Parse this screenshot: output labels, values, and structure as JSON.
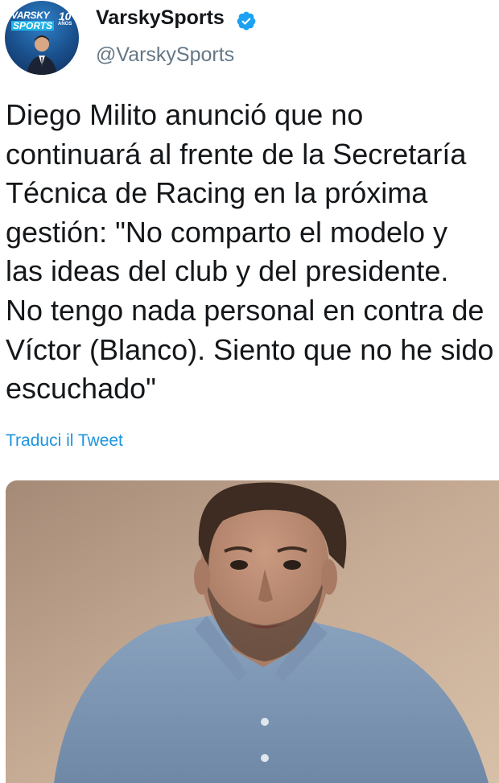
{
  "tweet": {
    "author": {
      "display_name": "VarskySports",
      "handle": "@VarskySports",
      "verified": true,
      "avatar": {
        "brand_line1": "VARSKY",
        "brand_line2": "SPORTS",
        "years_number": "10",
        "years_label": "AÑOS"
      }
    },
    "text": "Diego Milito anunció que no\ncontinuará al frente de la Secretaría\nTécnica de Racing en la próxima\ngestión: \"No comparto el modelo y\nlas ideas del club y del presidente.\nNo tengo nada personal en contra de\nVíctor (Blanco). Siento que no he sido\nescuchado\"",
    "translate_label": "Traduci il Tweet",
    "media": {
      "type": "video-still",
      "subject_icon": "person-photo"
    }
  },
  "colors": {
    "link": "#1b95e0",
    "verified_badge": "#1da1f2",
    "handle_gray": "#657786",
    "text": "#14171a"
  }
}
